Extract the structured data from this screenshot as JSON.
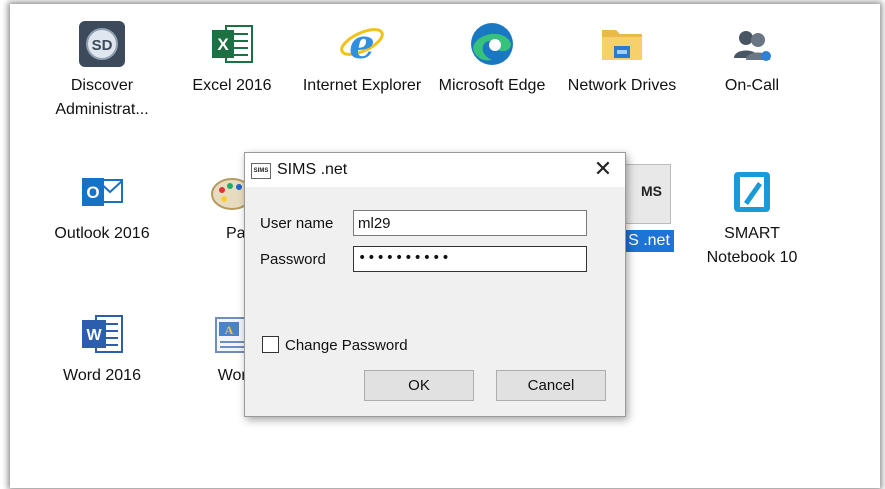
{
  "desktop": {
    "icons": [
      {
        "label": "Discover Administrat...",
        "icon": "discover-administrator-icon"
      },
      {
        "label": "Excel 2016",
        "icon": "excel-icon"
      },
      {
        "label": "Internet Explorer",
        "icon": "internet-explorer-icon"
      },
      {
        "label": "Microsoft Edge",
        "icon": "edge-icon"
      },
      {
        "label": "Network Drives",
        "icon": "folder-icon"
      },
      {
        "label": "On-Call",
        "icon": "people-icon"
      },
      {
        "label": "Outlook 2016",
        "icon": "outlook-icon"
      },
      {
        "label": "Pain",
        "icon": "paint-icon"
      },
      {
        "label": "S .net",
        "icon": "sims-icon"
      },
      {
        "label": "SMART Notebook 10",
        "icon": "smart-notebook-icon"
      },
      {
        "label": "Word 2016",
        "icon": "word-icon"
      },
      {
        "label": "WordP",
        "icon": "wordpad-icon"
      }
    ],
    "sims_icon_text": "MS",
    "colors": {
      "selection": "#1e73d6"
    }
  },
  "dialog": {
    "title": "SIMS .net",
    "app_icon_text": "SIMS",
    "close_glyph": "✕",
    "username_label": "User name",
    "username_value": "ml29",
    "password_label": "Password",
    "password_value": "••••••••••",
    "change_password_label": "Change Password",
    "change_password_checked": false,
    "ok_label": "OK",
    "cancel_label": "Cancel"
  }
}
